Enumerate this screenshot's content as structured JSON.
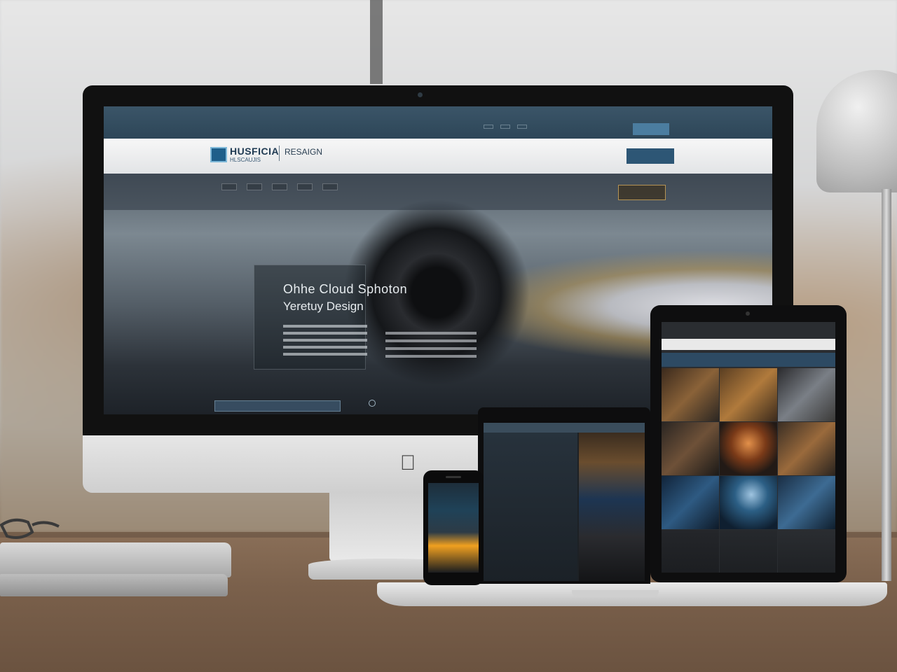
{
  "scene": {
    "accent": "#2d5675",
    "brand_blue": "#1f5f8a",
    "gold": "#b59455"
  },
  "imac": {
    "topbar": {
      "tagline": "",
      "links": [
        "",
        "",
        ""
      ],
      "button": ""
    },
    "header": {
      "logo_text": "HUSFICIA",
      "logo_sub": "HLSCAUJIS",
      "logo_right": "RESAIGN",
      "nav": [
        "",
        "",
        ""
      ],
      "button": ""
    },
    "hero": {
      "tabs": [
        "",
        "",
        "",
        "",
        ""
      ],
      "cta": "",
      "title": "Ohhe Cloud Sphoton",
      "subtitle": "Yeretuy Design",
      "caption": "",
      "icons": {
        "apple": "apple-logo-icon",
        "camera": "camera-lens-icon"
      }
    }
  },
  "laptop": {
    "title": "",
    "hero_text": ""
  },
  "tablet": {
    "logo": "",
    "nav": ""
  }
}
